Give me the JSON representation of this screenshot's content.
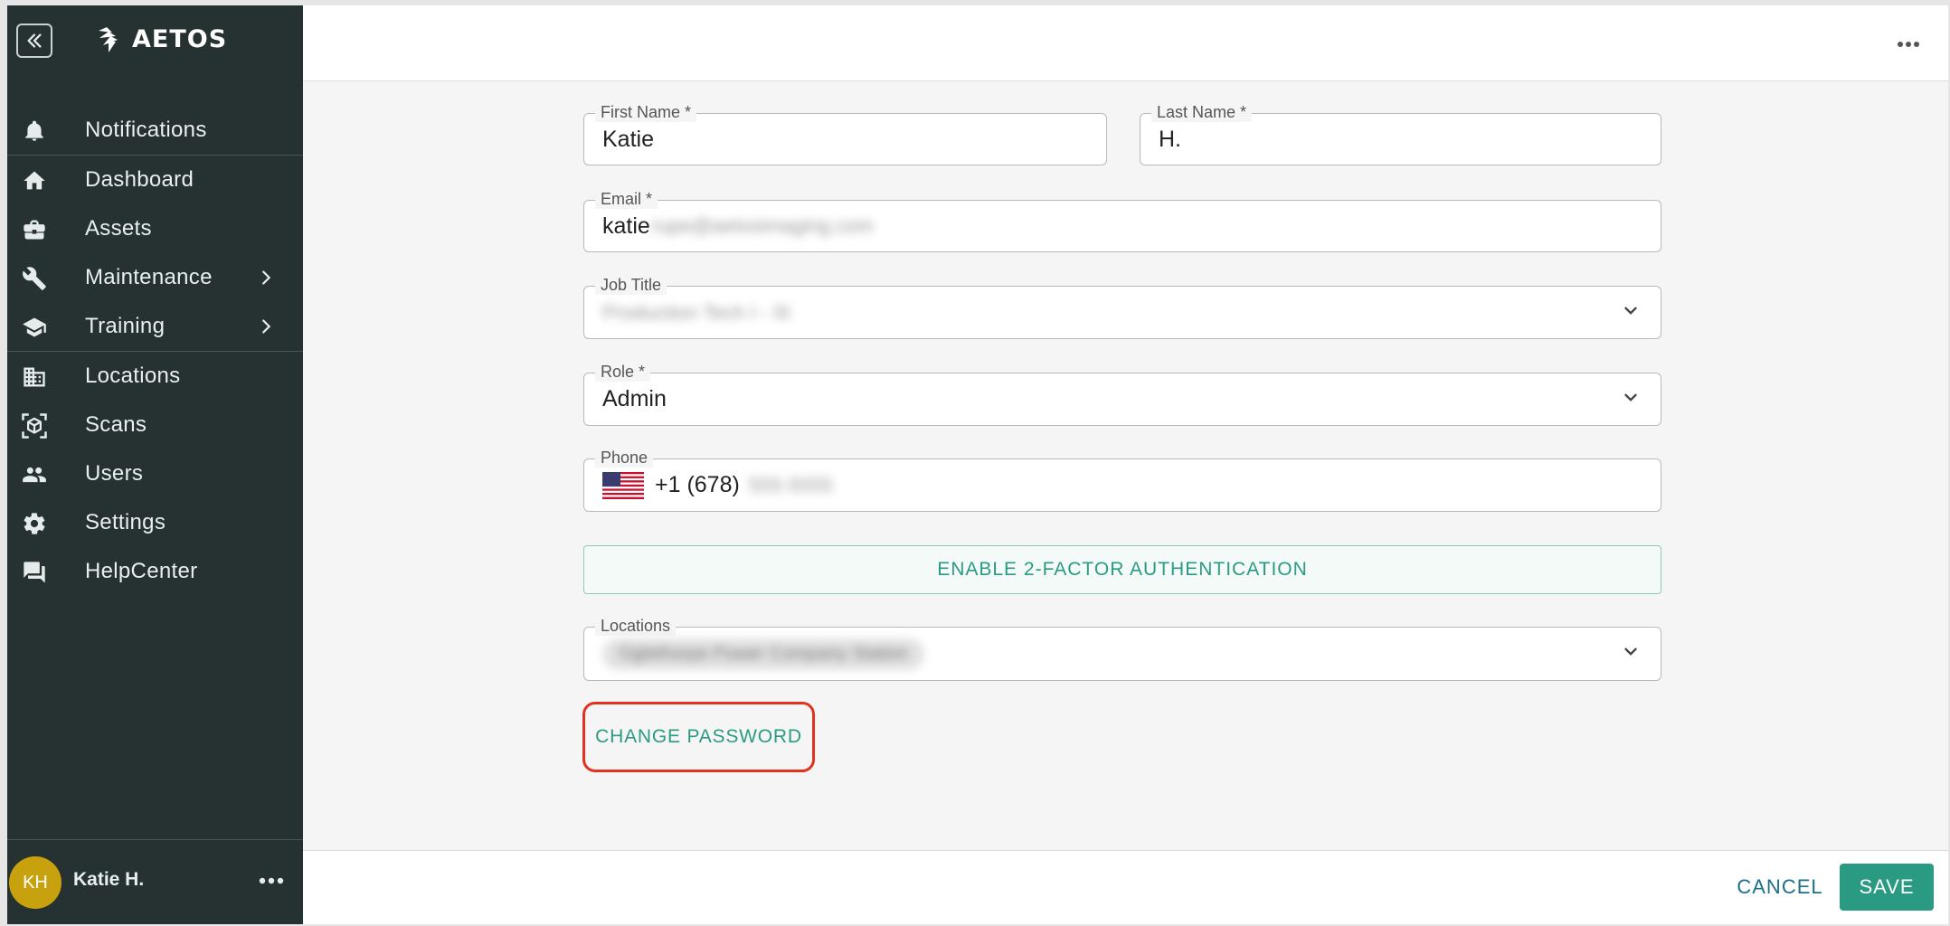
{
  "app": {
    "logo_text": "AETOS"
  },
  "sidebar": {
    "items": [
      {
        "label": "Notifications",
        "icon": "bell-icon"
      },
      {
        "label": "Dashboard",
        "icon": "home-icon"
      },
      {
        "label": "Assets",
        "icon": "briefcase-icon"
      },
      {
        "label": "Maintenance",
        "icon": "wrench-icon",
        "has_submenu": true
      },
      {
        "label": "Training",
        "icon": "graduation-cap-icon",
        "has_submenu": true
      },
      {
        "label": "Locations",
        "icon": "building-icon"
      },
      {
        "label": "Scans",
        "icon": "cube-scan-icon"
      },
      {
        "label": "Users",
        "icon": "people-icon"
      },
      {
        "label": "Settings",
        "icon": "gear-icon"
      },
      {
        "label": "HelpCenter",
        "icon": "chat-icon"
      }
    ],
    "user": {
      "initials": "KH",
      "name": "Katie H."
    }
  },
  "form": {
    "first_name": {
      "label": "First Name *",
      "value": "Katie"
    },
    "last_name": {
      "label": "Last Name *",
      "value": "H."
    },
    "email": {
      "label": "Email *",
      "value": "katie",
      "value_obscured": "rupe@aetosimaging.com"
    },
    "job_title": {
      "label": "Job Title",
      "value_obscured": "Production Tech I - III"
    },
    "role": {
      "label": "Role *",
      "value": "Admin"
    },
    "phone": {
      "label": "Phone",
      "value": "+1 (678)",
      "value_obscured": "555-5555"
    },
    "two_factor_button": "ENABLE 2-FACTOR AUTHENTICATION",
    "locations": {
      "label": "Locations",
      "chip_obscured": "Oglethorpe Power Company Station"
    },
    "change_password_button": "CHANGE PASSWORD"
  },
  "footer": {
    "cancel_label": "CANCEL",
    "save_label": "SAVE"
  },
  "colors": {
    "sidebar_bg": "#263231",
    "accent": "#2a9b82",
    "highlight": "#e0321f",
    "avatar": "#c8a10e"
  }
}
